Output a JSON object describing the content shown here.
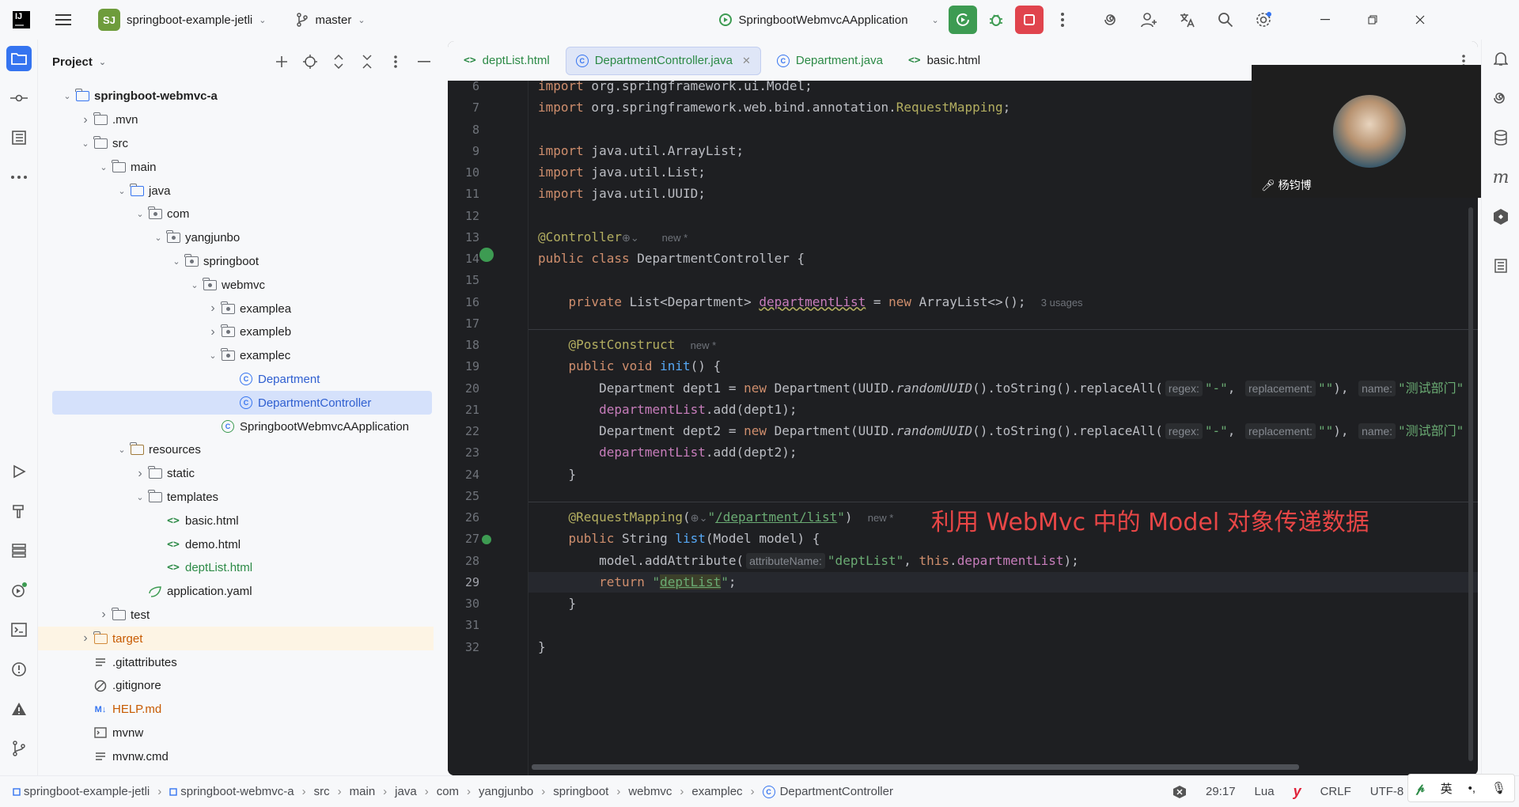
{
  "titlebar": {
    "project_badge": "SJ",
    "project_name": "springboot-example-jetli",
    "branch": "master",
    "run_config": "SpringbootWebmvcAApplication"
  },
  "project_panel": {
    "title": "Project",
    "tree": [
      {
        "label": "springboot-webmvc-a",
        "depth": 0,
        "kind": "module",
        "expanded": true,
        "bold": true
      },
      {
        "label": ".mvn",
        "depth": 1,
        "kind": "folder",
        "expanded": false
      },
      {
        "label": "src",
        "depth": 1,
        "kind": "folder",
        "expanded": true
      },
      {
        "label": "main",
        "depth": 2,
        "kind": "folder",
        "expanded": true
      },
      {
        "label": "java",
        "depth": 3,
        "kind": "srcfolder",
        "expanded": true
      },
      {
        "label": "com",
        "depth": 4,
        "kind": "package",
        "expanded": true
      },
      {
        "label": "yangjunbo",
        "depth": 5,
        "kind": "package",
        "expanded": true
      },
      {
        "label": "springboot",
        "depth": 6,
        "kind": "package",
        "expanded": true
      },
      {
        "label": "webmvc",
        "depth": 7,
        "kind": "package",
        "expanded": true
      },
      {
        "label": "examplea",
        "depth": 8,
        "kind": "package",
        "expanded": false
      },
      {
        "label": "exampleb",
        "depth": 8,
        "kind": "package",
        "expanded": false
      },
      {
        "label": "examplec",
        "depth": 8,
        "kind": "package",
        "expanded": true
      },
      {
        "label": "Department",
        "depth": 9,
        "kind": "class",
        "color": "blue"
      },
      {
        "label": "DepartmentController",
        "depth": 9,
        "kind": "class",
        "color": "blue",
        "selected": true
      },
      {
        "label": "SpringbootWebmvcAApplication",
        "depth": 8,
        "kind": "springclass"
      },
      {
        "label": "resources",
        "depth": 3,
        "kind": "resfolder",
        "expanded": true
      },
      {
        "label": "static",
        "depth": 4,
        "kind": "folder",
        "expanded": false
      },
      {
        "label": "templates",
        "depth": 4,
        "kind": "folder",
        "expanded": true
      },
      {
        "label": "basic.html",
        "depth": 5,
        "kind": "html"
      },
      {
        "label": "demo.html",
        "depth": 5,
        "kind": "html"
      },
      {
        "label": "deptList.html",
        "depth": 5,
        "kind": "html",
        "color": "green"
      },
      {
        "label": "application.yaml",
        "depth": 4,
        "kind": "yaml"
      },
      {
        "label": "test",
        "depth": 2,
        "kind": "folder",
        "expanded": false
      },
      {
        "label": "target",
        "depth": 1,
        "kind": "target",
        "expanded": false,
        "color": "orange"
      },
      {
        "label": ".gitattributes",
        "depth": 1,
        "kind": "text"
      },
      {
        "label": ".gitignore",
        "depth": 1,
        "kind": "ignore"
      },
      {
        "label": "HELP.md",
        "depth": 1,
        "kind": "md",
        "color": "orange"
      },
      {
        "label": "mvnw",
        "depth": 1,
        "kind": "shell"
      },
      {
        "label": "mvnw.cmd",
        "depth": 1,
        "kind": "text"
      }
    ]
  },
  "editor": {
    "tabs": [
      {
        "label": "deptList.html",
        "kind": "html",
        "color": "#2c8a46"
      },
      {
        "label": "DepartmentController.java",
        "kind": "class",
        "color": "#2c8a46",
        "active": true
      },
      {
        "label": "Department.java",
        "kind": "class",
        "color": "#2c8a46"
      },
      {
        "label": "basic.html",
        "kind": "html",
        "color": "#1f1f1f"
      }
    ],
    "lines": [
      {
        "n": "6",
        "html": "<span class=\"kw\">import</span> org.springframework.ui.Model;"
      },
      {
        "n": "7",
        "html": "<span class=\"kw\">import</span> org.springframework.web.bind.annotation.<span class=\"an\">RequestMapping</span>;"
      },
      {
        "n": "8",
        "html": ""
      },
      {
        "n": "9",
        "html": "<span class=\"kw\">import</span> java.util.ArrayList;"
      },
      {
        "n": "10",
        "html": "<span class=\"kw\">import</span> java.util.List;"
      },
      {
        "n": "11",
        "html": "<span class=\"kw\">import</span> java.util.UUID;"
      },
      {
        "n": "12",
        "html": ""
      },
      {
        "n": "13",
        "html": "<span class=\"an\">@Controller</span><span class=\"meta\">⊕⌄</span>   <span class=\"meta\">new *</span>"
      },
      {
        "n": "14",
        "html": "<span class=\"kw\">public class</span> DepartmentController {"
      },
      {
        "n": "15",
        "html": ""
      },
      {
        "n": "16",
        "html": "    <span class=\"kw\">private</span> List&lt;Department&gt; <span class=\"fld\" style=\"text-decoration:underline wavy #b3ae60\">departmentList</span> = <span class=\"kw\">new</span> ArrayList&lt;&gt;();  <span class=\"meta\">3 usages</span>"
      },
      {
        "n": "17",
        "html": ""
      },
      {
        "n": "18",
        "html": "    <span class=\"an\">@PostConstruct</span>  <span class=\"meta\">new *</span>"
      },
      {
        "n": "19",
        "html": "    <span class=\"kw\">public void</span> <span class=\"fn\">init</span>() {"
      },
      {
        "n": "20",
        "html": "        Department dept1 = <span class=\"kw\">new</span> Department(UUID.<span class=\"it\">randomUUID</span>().toString().replaceAll(<span class=\"hint\">regex:</span><span class=\"str\">\"-\"</span>, <span class=\"hint\">replacement:</span><span class=\"str\">\"\"</span>), <span class=\"hint\">name:</span><span class=\"str\">\"测试部门\"</span>"
      },
      {
        "n": "21",
        "html": "        <span class=\"fld\">departmentList</span>.add(dept1);"
      },
      {
        "n": "22",
        "html": "        Department dept2 = <span class=\"kw\">new</span> Department(UUID.<span class=\"it\">randomUUID</span>().toString().replaceAll(<span class=\"hint\">regex:</span><span class=\"str\">\"-\"</span>, <span class=\"hint\">replacement:</span><span class=\"str\">\"\"</span>), <span class=\"hint\">name:</span><span class=\"str\">\"测试部门\"</span>"
      },
      {
        "n": "23",
        "html": "        <span class=\"fld\">departmentList</span>.add(dept2);"
      },
      {
        "n": "24",
        "html": "    }"
      },
      {
        "n": "25",
        "html": ""
      },
      {
        "n": "26",
        "html": "    <span class=\"an\">@RequestMapping</span>(<span class=\"meta\">⊕⌄</span><span class=\"str\">\"<u>/department/list</u>\"</span>)  <span class=\"meta\">new *</span>"
      },
      {
        "n": "27",
        "html": "    <span class=\"kw\">public</span> String <span class=\"fn\">list</span>(Model model) {"
      },
      {
        "n": "28",
        "html": "        model.addAttribute(<span class=\"hint\">attributeName:</span><span class=\"str\">\"deptList\"</span>, <span class=\"kw\">this</span>.<span class=\"fld\">departmentList</span>);"
      },
      {
        "n": "29",
        "html": "        <span class=\"kw\">return</span> <span class=\"str\">\"<span style=\"background:#3b3f2a;text-decoration:underline\">deptList</span>\"</span>;",
        "current": true
      },
      {
        "n": "30",
        "html": "    }"
      },
      {
        "n": "31",
        "html": ""
      },
      {
        "n": "32",
        "html": "}"
      }
    ],
    "annotation_note": "利用 WebMvc 中的 Model 对象传递数据"
  },
  "webcam": {
    "name": "杨钧博"
  },
  "statusbar": {
    "breadcrumbs": [
      "springboot-example-jetli",
      "springboot-webmvc-a",
      "src",
      "main",
      "java",
      "com",
      "yangjunbo",
      "springboot",
      "webmvc",
      "examplec",
      "DepartmentController"
    ],
    "position": "29:17",
    "language": "Lua",
    "line_sep": "CRLF",
    "encoding": "UTF-8"
  },
  "ime": {
    "lang": "英",
    "punct": "•,"
  }
}
